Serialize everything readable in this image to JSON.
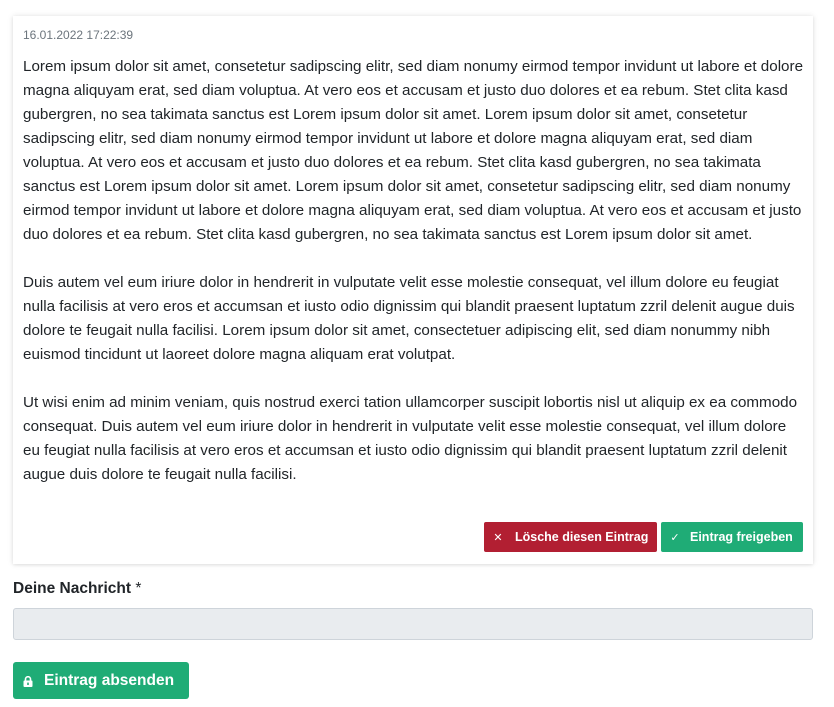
{
  "entry": {
    "timestamp": "16.01.2022 17:22:39",
    "paragraphs": [
      "Lorem ipsum dolor sit amet, consetetur sadipscing elitr, sed diam nonumy eirmod tempor invidunt ut labore et dolore magna aliquyam erat, sed diam voluptua. At vero eos et accusam et justo duo dolores et ea rebum. Stet clita kasd gubergren, no sea takimata sanctus est Lorem ipsum dolor sit amet. Lorem ipsum dolor sit amet, consetetur sadipscing elitr, sed diam nonumy eirmod tempor invidunt ut labore et dolore magna aliquyam erat, sed diam voluptua. At vero eos et accusam et justo duo dolores et ea rebum. Stet clita kasd gubergren, no sea takimata sanctus est Lorem ipsum dolor sit amet. Lorem ipsum dolor sit amet, consetetur sadipscing elitr, sed diam nonumy eirmod tempor invidunt ut labore et dolore magna aliquyam erat, sed diam voluptua. At vero eos et accusam et justo duo dolores et ea rebum. Stet clita kasd gubergren, no sea takimata sanctus est Lorem ipsum dolor sit amet.",
      "Duis autem vel eum iriure dolor in hendrerit in vulputate velit esse molestie consequat, vel illum dolore eu feugiat nulla facilisis at vero eros et accumsan et iusto odio dignissim qui blandit praesent luptatum zzril delenit augue duis dolore te feugait nulla facilisi. Lorem ipsum dolor sit amet, consectetuer adipiscing elit, sed diam nonummy nibh euismod tincidunt ut laoreet dolore magna aliquam erat volutpat.",
      "Ut wisi enim ad minim veniam, quis nostrud exerci tation ullamcorper suscipit lobortis nisl ut aliquip ex ea commodo consequat. Duis autem vel eum iriure dolor in hendrerit in vulputate velit esse molestie consequat, vel illum dolore eu feugiat nulla facilisis at vero eros et accumsan et iusto odio dignissim qui blandit praesent luptatum zzril delenit augue duis dolore te feugait nulla facilisi."
    ],
    "actions": {
      "delete_label": "Lösche diesen Eintrag",
      "delete_icon": "close-icon",
      "approve_label": "Eintrag freigeben",
      "approve_icon": "check-icon"
    }
  },
  "form": {
    "message_label": "Deine Nachricht",
    "required_marker": "*",
    "message_value": "",
    "message_placeholder": "",
    "submit_label": "Eintrag absenden",
    "submit_icon": "lock-icon"
  },
  "colors": {
    "danger": "#b21f32",
    "success": "#1fac76",
    "input_background": "#e9ecef",
    "text": "#212529",
    "muted": "#6c757d"
  }
}
